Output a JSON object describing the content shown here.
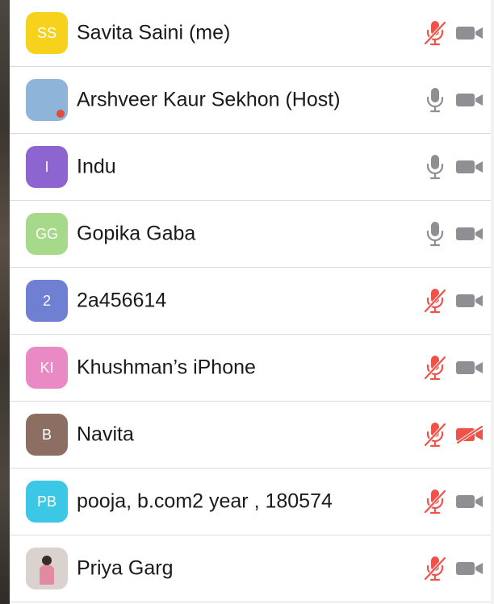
{
  "participants": [
    {
      "initials": "SS",
      "name": "Savita Saini (me)",
      "avatar_color": "#f7d21c",
      "avatar_type": "initials",
      "mic": "muted",
      "camera": "on"
    },
    {
      "initials": "",
      "name": "Arshveer Kaur Sekhon (Host)",
      "avatar_color": "#8fb4d9",
      "avatar_type": "photo-building",
      "mic": "on",
      "camera": "on"
    },
    {
      "initials": "I",
      "name": "Indu",
      "avatar_color": "#8e64d0",
      "avatar_type": "initials",
      "mic": "on",
      "camera": "on"
    },
    {
      "initials": "GG",
      "name": "Gopika Gaba",
      "avatar_color": "#a7d98a",
      "avatar_type": "initials",
      "mic": "on",
      "camera": "on"
    },
    {
      "initials": "2",
      "name": "2a456614",
      "avatar_color": "#6f7fd1",
      "avatar_type": "initials",
      "mic": "muted",
      "camera": "on"
    },
    {
      "initials": "KI",
      "name": "Khushman’s iPhone",
      "avatar_color": "#ea8ac4",
      "avatar_type": "initials",
      "mic": "muted",
      "camera": "on"
    },
    {
      "initials": "B",
      "name": "Navita",
      "avatar_color": "#8d6e63",
      "avatar_type": "initials",
      "mic": "muted",
      "camera": "off"
    },
    {
      "initials": "PB",
      "name": "pooja, b.com2 year , 180574",
      "avatar_color": "#3cc7e6",
      "avatar_type": "initials",
      "mic": "muted",
      "camera": "on"
    },
    {
      "initials": "",
      "name": "Priya Garg",
      "avatar_color": "#d9d2cf",
      "avatar_type": "photo-person",
      "mic": "muted",
      "camera": "on"
    }
  ],
  "colors": {
    "icon_gray": "#8e8e93",
    "muted_red": "#f0524a",
    "divider": "#dcdcdc",
    "text": "#1a1a1a"
  },
  "icons": {
    "mic_on": "microphone-icon",
    "mic_muted": "microphone-muted-icon",
    "cam_on": "video-camera-icon",
    "cam_off": "video-camera-off-icon"
  }
}
